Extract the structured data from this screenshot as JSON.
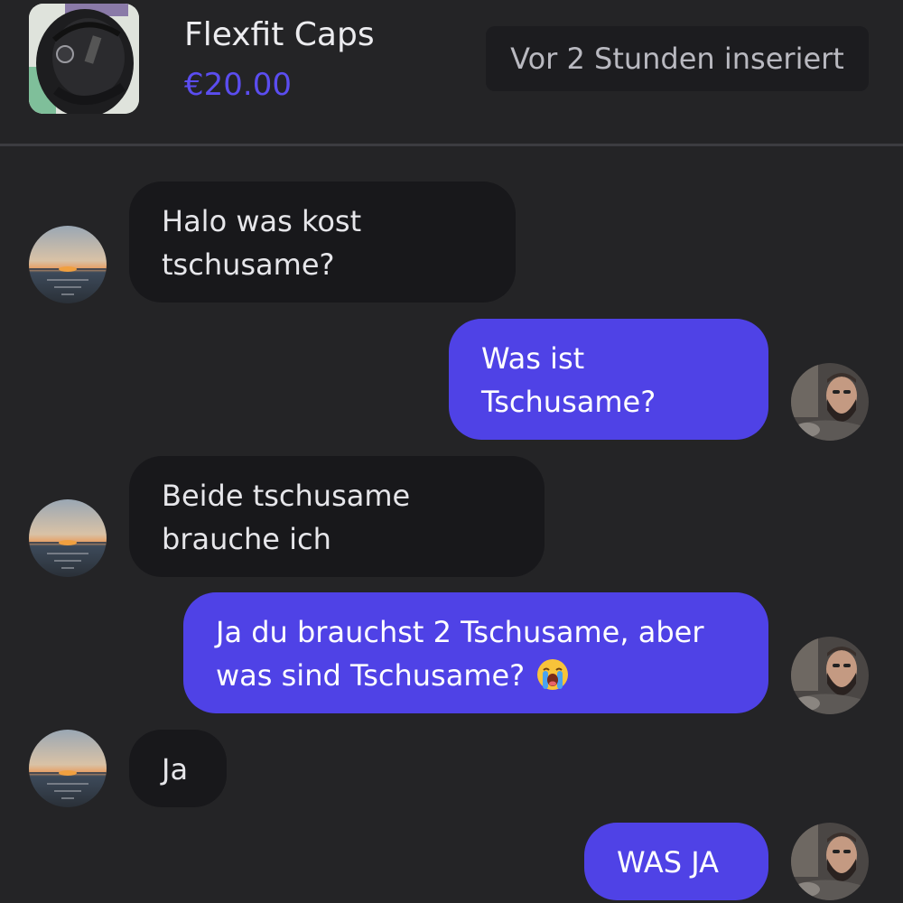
{
  "product": {
    "title": "Flexfit Caps",
    "price": "€20.00",
    "posted": "Vor 2 Stunden inseriert",
    "thumbnail_icon": "cap-photo"
  },
  "colors": {
    "background": "#242426",
    "incoming_bubble": "#18181b",
    "outgoing_bubble": "#4f42e6",
    "price_accent": "#5b4df0"
  },
  "messages": [
    {
      "sender": "other",
      "lines": [
        "Halo was kost",
        "tschusame?"
      ]
    },
    {
      "sender": "me",
      "lines": [
        "Was ist",
        "Tschusame?"
      ]
    },
    {
      "sender": "other",
      "lines": [
        "Beide tschusame",
        "brauche ich"
      ]
    },
    {
      "sender": "me",
      "lines": [
        "Ja du brauchst 2 Tschusame, aber",
        "was sind Tschusame?"
      ],
      "emoji": "loudly-crying-face"
    },
    {
      "sender": "other",
      "lines": [
        "Ja"
      ]
    },
    {
      "sender": "me",
      "lines": [
        "WAS JA"
      ]
    }
  ]
}
